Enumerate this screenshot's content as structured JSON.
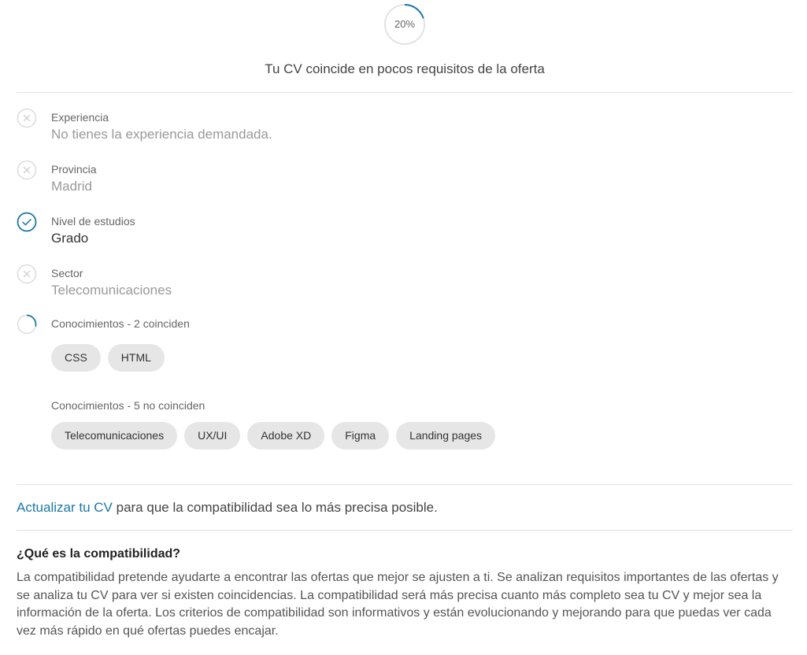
{
  "score": {
    "percent_label": "20%",
    "fraction": 0.2,
    "summary": "Tu CV coincide en pocos requisitos de la oferta"
  },
  "requirements": [
    {
      "label": "Experiencia",
      "value": "No tienes la experiencia demandada.",
      "status": "no-match"
    },
    {
      "label": "Provincia",
      "value": "Madrid",
      "status": "no-match"
    },
    {
      "label": "Nivel de estudios",
      "value": "Grado",
      "status": "match"
    },
    {
      "label": "Sector",
      "value": "Telecomunicaciones",
      "status": "no-match"
    }
  ],
  "knowledge": {
    "matched_label": "Conocimientos - 2 coinciden",
    "matched_fraction": 0.2857,
    "matched": [
      "CSS",
      "HTML"
    ],
    "unmatched_label": "Conocimientos - 5 no coinciden",
    "unmatched": [
      "Telecomunicaciones",
      "UX/UI",
      "Adobe XD",
      "Figma",
      "Landing pages"
    ]
  },
  "update": {
    "link_text": "Actualizar tu CV",
    "rest_text": " para que la compatibilidad sea lo más precisa posible."
  },
  "about": {
    "title": "¿Qué es la compatibilidad?",
    "body": "La compatibilidad pretende ayudarte a encontrar las ofertas que mejor se ajusten a ti. Se analizan requisitos importantes de las ofertas y se analiza tu CV para ver si existen coincidencias. La compatibilidad será más precisa cuanto más completo sea tu CV y mejor sea la información de la oferta. Los criterios de compatibilidad son informativos y están evolucionando y mejorando para que puedas ver cada vez más rápido en qué ofertas puedes encajar."
  },
  "colors": {
    "accent": "#1a78a6",
    "ring_track": "#e2e2e2",
    "chip_bg": "#e6e6e6"
  }
}
